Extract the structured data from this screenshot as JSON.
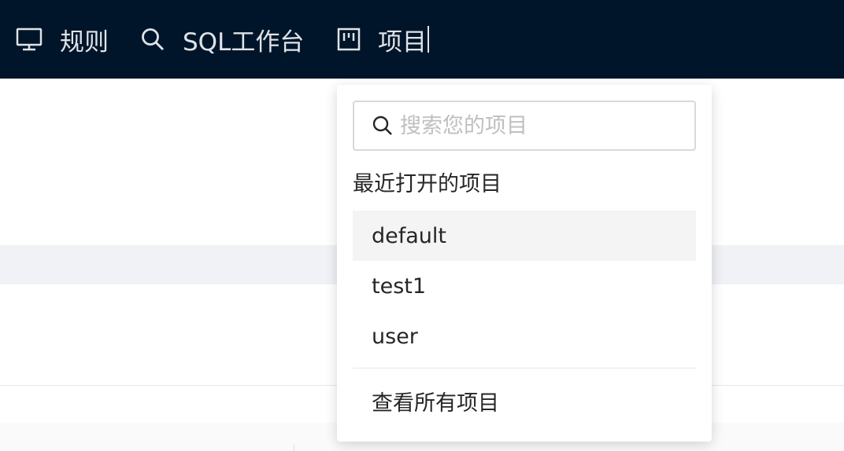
{
  "nav": {
    "items": [
      {
        "label": "规则",
        "icon": "monitor-icon"
      },
      {
        "label": "SQL工作台",
        "icon": "search-icon"
      },
      {
        "label": "项目",
        "icon": "project-icon"
      }
    ]
  },
  "dropdown": {
    "search_placeholder": "搜索您的项目",
    "recent_title": "最近打开的项目",
    "items": [
      {
        "label": "default"
      },
      {
        "label": "test1"
      },
      {
        "label": "user"
      }
    ],
    "view_all": "查看所有项目"
  },
  "colors": {
    "topbar_bg": "#001529",
    "nav_text": "#dfe3e8",
    "item_hover_bg": "#f4f4f4"
  }
}
